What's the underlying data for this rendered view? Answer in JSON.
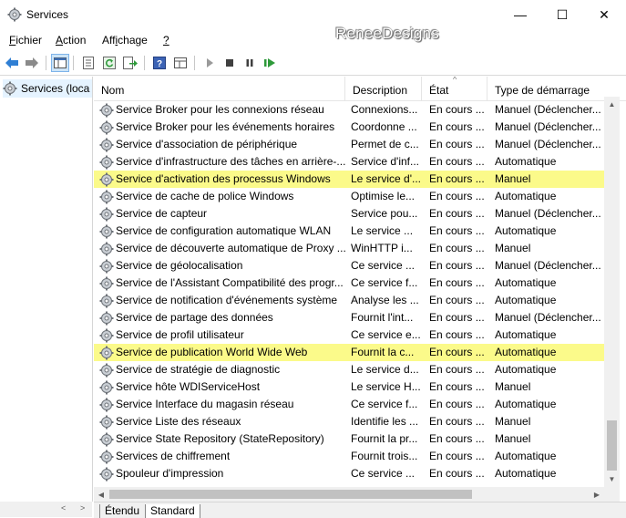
{
  "window": {
    "title": "Services",
    "watermark": "ReneeDesigns",
    "buttons": {
      "minimize": "—",
      "maximize": "☐",
      "close": "✕"
    }
  },
  "menu": [
    {
      "label": "Fichier",
      "key": "F",
      "rest": "ichier"
    },
    {
      "label": "Action",
      "key": "A",
      "rest": "ction"
    },
    {
      "label": "Affichage",
      "pre": "Aff",
      "key": "i",
      "rest": "chage"
    },
    {
      "label": "?",
      "key": "?",
      "rest": ""
    }
  ],
  "toolbar": {
    "icons": [
      "back-arrow-icon",
      "forward-arrow-icon",
      "console-tree-icon",
      "properties-icon",
      "refresh-icon",
      "export-list-icon",
      "help-icon",
      "view-icon",
      "start-service-icon",
      "stop-service-icon",
      "pause-service-icon",
      "restart-service-icon"
    ]
  },
  "tree": {
    "root_label": "Services (loca"
  },
  "columns": {
    "name": "Nom",
    "description": "Description",
    "state": "État",
    "startup": "Type de démarrage"
  },
  "services": [
    {
      "name": "Service Broker pour les connexions réseau",
      "description": "Connexions...",
      "state": "En cours ...",
      "startup": "Manuel (Déclencher...",
      "highlighted": false
    },
    {
      "name": "Service Broker pour les événements horaires",
      "description": "Coordonne ...",
      "state": "En cours ...",
      "startup": "Manuel (Déclencher...",
      "highlighted": false
    },
    {
      "name": "Service d'association de périphérique",
      "description": "Permet de c...",
      "state": "En cours ...",
      "startup": "Manuel (Déclencher...",
      "highlighted": false
    },
    {
      "name": "Service d'infrastructure des tâches en arrière-...",
      "description": "Service d'inf...",
      "state": "En cours ...",
      "startup": "Automatique",
      "highlighted": false
    },
    {
      "name": "Service d'activation des processus Windows",
      "description": "Le service d'...",
      "state": "En cours ...",
      "startup": "Manuel",
      "highlighted": true
    },
    {
      "name": "Service de cache de police Windows",
      "description": "Optimise le...",
      "state": "En cours ...",
      "startup": "Automatique",
      "highlighted": false
    },
    {
      "name": "Service de capteur",
      "description": "Service pou...",
      "state": "En cours ...",
      "startup": "Manuel (Déclencher...",
      "highlighted": false
    },
    {
      "name": "Service de configuration automatique WLAN",
      "description": "Le service ...",
      "state": "En cours ...",
      "startup": "Automatique",
      "highlighted": false
    },
    {
      "name": "Service de découverte automatique de Proxy ...",
      "description": "WinHTTP i...",
      "state": "En cours ...",
      "startup": "Manuel",
      "highlighted": false
    },
    {
      "name": "Service de géolocalisation",
      "description": "Ce service ...",
      "state": "En cours ...",
      "startup": "Manuel (Déclencher...",
      "highlighted": false
    },
    {
      "name": "Service de l'Assistant Compatibilité des progr...",
      "description": "Ce service f...",
      "state": "En cours ...",
      "startup": "Automatique",
      "highlighted": false
    },
    {
      "name": "Service de notification d'événements système",
      "description": "Analyse les ...",
      "state": "En cours ...",
      "startup": "Automatique",
      "highlighted": false
    },
    {
      "name": "Service de partage des données",
      "description": "Fournit l'int...",
      "state": "En cours ...",
      "startup": "Manuel (Déclencher...",
      "highlighted": false
    },
    {
      "name": "Service de profil utilisateur",
      "description": "Ce service e...",
      "state": "En cours ...",
      "startup": "Automatique",
      "highlighted": false
    },
    {
      "name": "Service de publication World Wide Web",
      "description": "Fournit la c...",
      "state": "En cours ...",
      "startup": "Automatique",
      "highlighted": true
    },
    {
      "name": "Service de stratégie de diagnostic",
      "description": "Le service d...",
      "state": "En cours ...",
      "startup": "Automatique",
      "highlighted": false
    },
    {
      "name": "Service hôte WDIServiceHost",
      "description": "Le service H...",
      "state": "En cours ...",
      "startup": "Manuel",
      "highlighted": false
    },
    {
      "name": "Service Interface du magasin réseau",
      "description": "Ce service f...",
      "state": "En cours ...",
      "startup": "Automatique",
      "highlighted": false
    },
    {
      "name": "Service Liste des réseaux",
      "description": "Identifie les ...",
      "state": "En cours ...",
      "startup": "Manuel",
      "highlighted": false
    },
    {
      "name": "Service State Repository (StateRepository)",
      "description": "Fournit la pr...",
      "state": "En cours ...",
      "startup": "Manuel",
      "highlighted": false
    },
    {
      "name": "Services de chiffrement",
      "description": "Fournit trois...",
      "state": "En cours ...",
      "startup": "Automatique",
      "highlighted": false
    },
    {
      "name": "Spouleur d'impression",
      "description": "Ce service ...",
      "state": "En cours ...",
      "startup": "Automatique",
      "highlighted": false
    }
  ],
  "tabs": [
    {
      "label": "Étendu"
    },
    {
      "label": "Standard"
    }
  ],
  "highlight_color": "#fbfa8a"
}
